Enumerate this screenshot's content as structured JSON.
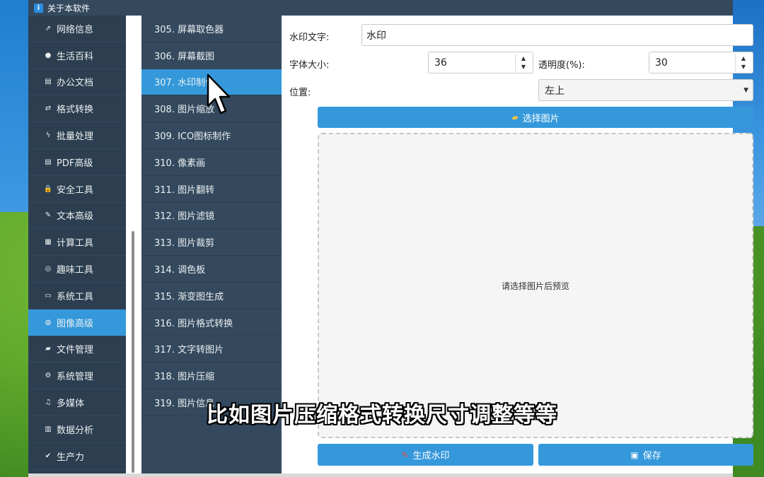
{
  "window": {
    "title": "关于本软件",
    "icon_letter": "i"
  },
  "sidebar": {
    "items": [
      {
        "label": "网络信息",
        "icon": "network-icon",
        "glyph": "⇗"
      },
      {
        "label": "生活百科",
        "icon": "life-icon",
        "glyph": "●"
      },
      {
        "label": "办公文档",
        "icon": "document-icon",
        "glyph": "▤"
      },
      {
        "label": "格式转换",
        "icon": "convert-icon",
        "glyph": "⇄"
      },
      {
        "label": "批量处理",
        "icon": "lightning-icon",
        "glyph": "ϟ"
      },
      {
        "label": "PDF高级",
        "icon": "pdf-icon",
        "glyph": "▤"
      },
      {
        "label": "安全工具",
        "icon": "lock-icon",
        "glyph": "🔒"
      },
      {
        "label": "文本高级",
        "icon": "text-icon",
        "glyph": "✎"
      },
      {
        "label": "计算工具",
        "icon": "calculator-icon",
        "glyph": "▦"
      },
      {
        "label": "趣味工具",
        "icon": "target-icon",
        "glyph": "◎"
      },
      {
        "label": "系统工具",
        "icon": "monitor-icon",
        "glyph": "▭"
      },
      {
        "label": "图像高级",
        "icon": "palette-icon",
        "glyph": "◍"
      },
      {
        "label": "文件管理",
        "icon": "folder-icon",
        "glyph": "▰"
      },
      {
        "label": "系统管理",
        "icon": "gear-icon",
        "glyph": "⚙"
      },
      {
        "label": "多媒体",
        "icon": "media-icon",
        "glyph": "♫"
      },
      {
        "label": "数据分析",
        "icon": "chart-icon",
        "glyph": "▥"
      },
      {
        "label": "生产力",
        "icon": "productivity-icon",
        "glyph": "✔"
      }
    ],
    "active_index": 11
  },
  "submenu": {
    "items": [
      "305. 屏幕取色器",
      "306. 屏幕截图",
      "307. 水印制作",
      "308. 图片缩放",
      "309. ICO图标制作",
      "310. 像素画",
      "311. 图片翻转",
      "312. 图片滤镜",
      "313. 图片裁剪",
      "314. 调色板",
      "315. 渐变图生成",
      "316. 图片格式转换",
      "317. 文字转图片",
      "318. 图片压缩",
      "319. 图片信息"
    ],
    "active_index": 2
  },
  "form": {
    "watermark_label": "水印文字:",
    "watermark_value": "水印",
    "font_size_label": "字体大小:",
    "font_size_value": "36",
    "opacity_label": "透明度(%):",
    "opacity_value": "30",
    "position_label": "位置:",
    "position_value": "左上",
    "select_image_label": "选择图片",
    "preview_placeholder": "请选择图片后预览",
    "generate_label": "生成水印",
    "save_label": "保存"
  },
  "subtitle": "比如图片压缩格式转换尺寸调整等等",
  "colors": {
    "accent": "#3498db",
    "sidebar_bg": "#2c3e50",
    "submenu_bg": "#34495e"
  }
}
